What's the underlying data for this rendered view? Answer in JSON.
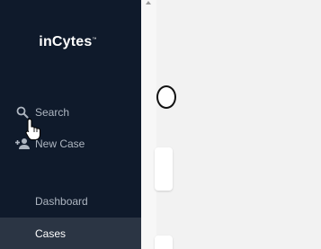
{
  "brand": {
    "name": "inCytes",
    "trademark": "™"
  },
  "actions": {
    "search": {
      "label": "Search",
      "icon": "search-icon"
    },
    "new_case": {
      "label": "New Case",
      "icon": "add-person-icon"
    }
  },
  "nav": {
    "items": [
      {
        "label": "Dashboard",
        "active": false
      },
      {
        "label": "Cases",
        "active": true
      }
    ]
  },
  "colors": {
    "sidebar_bg": "#0f1a2b",
    "active_item_bg": "#2b3544",
    "muted_text": "#aeb6c1",
    "content_bg": "#f2f2f2"
  }
}
